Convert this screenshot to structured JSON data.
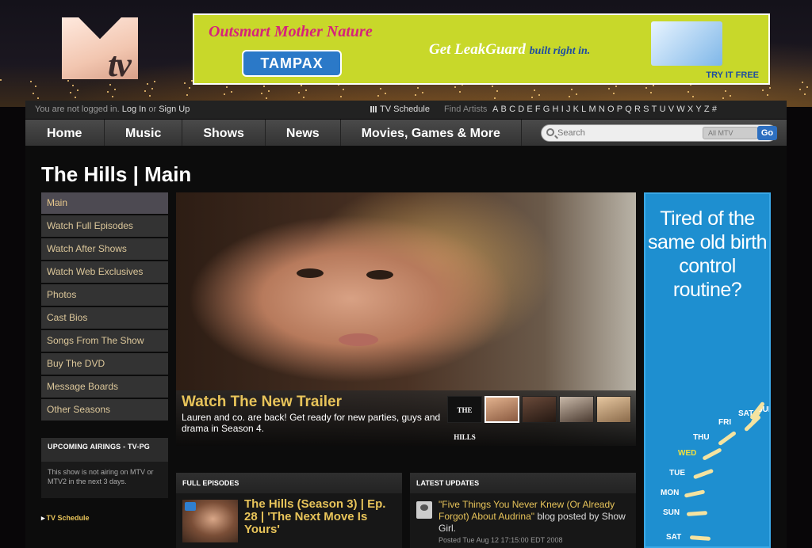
{
  "header": {
    "logo_text": "MTV",
    "banner_ad": {
      "headline": "Outsmart Mother Nature",
      "brand": "TAMPAX",
      "tagline": "Get LeakGuard",
      "tagline_suffix": "built right in.",
      "cta": "TRY IT FREE"
    }
  },
  "topbar": {
    "not_logged_in": "You are not logged in.",
    "log_in": "Log In",
    "or": "or",
    "sign_up": "Sign Up",
    "tv_schedule": "TV Schedule",
    "find_artists": "Find Artists",
    "letters": [
      "A",
      "B",
      "C",
      "D",
      "E",
      "F",
      "G",
      "H",
      "I",
      "J",
      "K",
      "L",
      "M",
      "N",
      "O",
      "P",
      "Q",
      "R",
      "S",
      "T",
      "U",
      "V",
      "W",
      "X",
      "Y",
      "Z",
      "#"
    ]
  },
  "nav": {
    "items": [
      "Home",
      "Music",
      "Shows",
      "News",
      "Movies, Games & More"
    ]
  },
  "search": {
    "placeholder": "Search",
    "scope": "All MTV",
    "go": "Go"
  },
  "page": {
    "title": "The Hills | Main"
  },
  "sidebar": {
    "items": [
      {
        "label": "Main",
        "active": true
      },
      {
        "label": "Watch Full Episodes"
      },
      {
        "label": "Watch After Shows"
      },
      {
        "label": "Watch Web Exclusives"
      },
      {
        "label": "Photos"
      },
      {
        "label": "Cast Bios"
      },
      {
        "label": "Songs From The Show"
      },
      {
        "label": "Buy The DVD"
      },
      {
        "label": "Message Boards"
      },
      {
        "label": "Other Seasons"
      }
    ],
    "airings_title": "UPCOMING AIRINGS - TV-PG",
    "airings_text": "This show is not airing on MTV or MTV2 in the next 3 days.",
    "tv_schedule_link": "TV Schedule"
  },
  "hero": {
    "title": "Watch The New Trailer",
    "text": "Lauren and co. are back! Get ready for new parties, guys and drama in Season 4.",
    "thumb_logo": "THE HILLS"
  },
  "full_episodes": {
    "header": "FULL EPISODES",
    "title": "The Hills (Season 3) | Ep. 28 | 'The Next Move Is Yours'"
  },
  "latest_updates": {
    "header": "LATEST UPDATES",
    "link": "\"Five Things You Never Knew (Or Already Forgot) About Audrina\"",
    "rest": " blog posted by Show Girl.",
    "posted": "Posted Tue Aug 12 17:15:00 EDT 2008"
  },
  "side_ad": {
    "headline": "Tired of the same old birth control routine?",
    "days": [
      "SAT",
      "SUN",
      "FRI",
      "THU",
      "WED",
      "TUE",
      "MON",
      "SUN",
      "SAT"
    ]
  }
}
